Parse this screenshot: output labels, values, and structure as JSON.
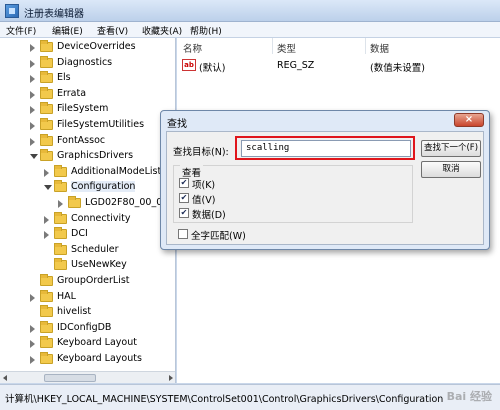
{
  "window": {
    "title": "注册表编辑器"
  },
  "menu": [
    "文件(F)",
    "编辑(E)",
    "查看(V)",
    "收藏夹(A)",
    "帮助(H)"
  ],
  "tree": [
    {
      "label": "DeviceOverrides",
      "level": 0,
      "toggle": "closed"
    },
    {
      "label": "Diagnostics",
      "level": 0,
      "toggle": "closed"
    },
    {
      "label": "Els",
      "level": 0,
      "toggle": "closed"
    },
    {
      "label": "Errata",
      "level": 0,
      "toggle": "closed"
    },
    {
      "label": "FileSystem",
      "level": 0,
      "toggle": "closed"
    },
    {
      "label": "FileSystemUtilities",
      "level": 0,
      "toggle": "closed"
    },
    {
      "label": "FontAssoc",
      "level": 0,
      "toggle": "closed"
    },
    {
      "label": "GraphicsDrivers",
      "level": 0,
      "toggle": "open"
    },
    {
      "label": "AdditionalModeLists",
      "level": 1,
      "toggle": "closed"
    },
    {
      "label": "Configuration",
      "level": 1,
      "toggle": "open",
      "selected": true
    },
    {
      "label": "LGD02F80_00_07",
      "level": 2,
      "toggle": "closed"
    },
    {
      "label": "Connectivity",
      "level": 1,
      "toggle": "closed"
    },
    {
      "label": "DCI",
      "level": 1,
      "toggle": "closed"
    },
    {
      "label": "Scheduler",
      "level": 1,
      "toggle": "none"
    },
    {
      "label": "UseNewKey",
      "level": 1,
      "toggle": "none"
    },
    {
      "label": "GroupOrderList",
      "level": 0,
      "toggle": "none"
    },
    {
      "label": "HAL",
      "level": 0,
      "toggle": "closed"
    },
    {
      "label": "hivelist",
      "level": 0,
      "toggle": "none"
    },
    {
      "label": "IDConfigDB",
      "level": 0,
      "toggle": "closed"
    },
    {
      "label": "Keyboard Layout",
      "level": 0,
      "toggle": "closed"
    },
    {
      "label": "Keyboard Layouts",
      "level": 0,
      "toggle": "closed"
    }
  ],
  "list": {
    "headers": {
      "name": "名称",
      "type": "类型",
      "data": "数据"
    },
    "rows": [
      {
        "icon": "ab",
        "name": "(默认)",
        "type": "REG_SZ",
        "data": "(数值未设置)"
      }
    ]
  },
  "status": "计算机\\HKEY_LOCAL_MACHINE\\SYSTEM\\ControlSet001\\Control\\GraphicsDrivers\\Configuration",
  "dialog": {
    "title": "查找",
    "close": "×",
    "find_label": "查找目标(N):",
    "find_value": "scalling",
    "find_next": "查找下一个(F)",
    "cancel": "取消",
    "look_in": "查看",
    "options": [
      {
        "label": "项(K)",
        "checked": true
      },
      {
        "label": "值(V)",
        "checked": true
      },
      {
        "label": "数据(D)",
        "checked": true
      }
    ],
    "match_whole": {
      "label": "全字匹配(W)",
      "checked": false
    }
  },
  "watermark": "Bai 经验"
}
